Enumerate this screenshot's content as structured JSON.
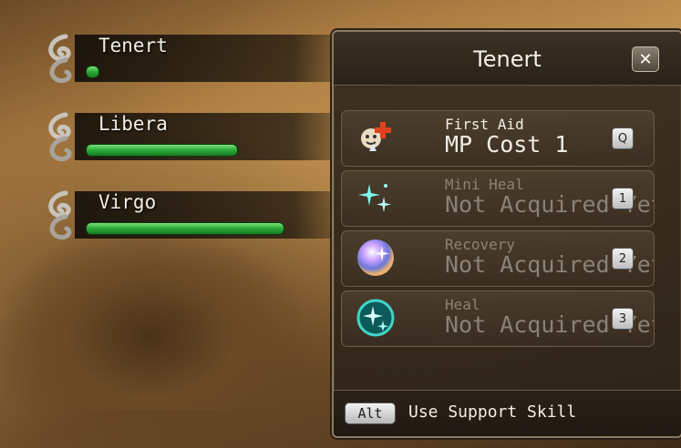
{
  "party": [
    {
      "name": "Tenert",
      "hp_fraction": 0.06
    },
    {
      "name": "Libera",
      "hp_fraction": 0.75
    },
    {
      "name": "Virgo",
      "hp_fraction": 0.98
    }
  ],
  "panel": {
    "title": "Tenert",
    "close_label": "✕",
    "skills": [
      {
        "name": "First Aid",
        "detail": "MP Cost 1",
        "key": "Q",
        "acquired": true,
        "icon": "first-aid-icon"
      },
      {
        "name": "Mini Heal",
        "detail": "Not Acquired Yet",
        "key": "1",
        "acquired": false,
        "icon": "mini-heal-icon"
      },
      {
        "name": "Recovery",
        "detail": "Not Acquired Yet",
        "key": "2",
        "acquired": false,
        "icon": "recovery-icon"
      },
      {
        "name": "Heal",
        "detail": "Not Acquired Yet",
        "key": "3",
        "acquired": false,
        "icon": "heal-icon"
      }
    ],
    "footer": {
      "key": "Alt",
      "label": "Use Support Skill"
    }
  },
  "colors": {
    "hp_bar": "#2fae3a",
    "panel_border": "#8a7a62"
  }
}
